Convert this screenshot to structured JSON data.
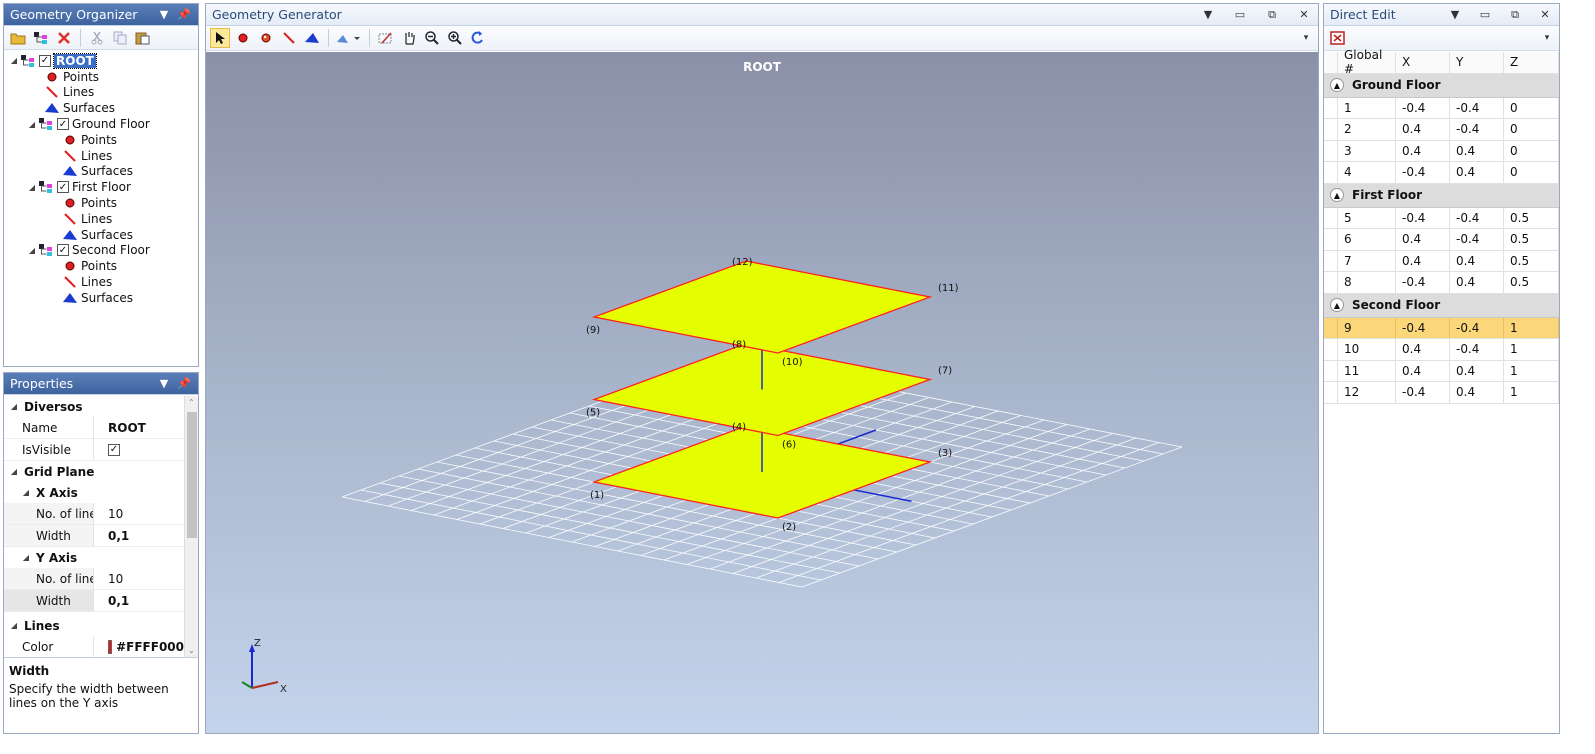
{
  "organizer": {
    "title": "Geometry Organizer",
    "tree": [
      {
        "label": "ROOT",
        "type": "group",
        "level": 0,
        "checked": true,
        "selected": true
      },
      {
        "label": "Points",
        "type": "points",
        "level": 1
      },
      {
        "label": "Lines",
        "type": "lines",
        "level": 1
      },
      {
        "label": "Surfaces",
        "type": "surfaces",
        "level": 1
      },
      {
        "label": "Ground Floor",
        "type": "group",
        "level": 1,
        "checked": true
      },
      {
        "label": "Points",
        "type": "points",
        "level": 2
      },
      {
        "label": "Lines",
        "type": "lines",
        "level": 2
      },
      {
        "label": "Surfaces",
        "type": "surfaces",
        "level": 2
      },
      {
        "label": "First Floor",
        "type": "group",
        "level": 1,
        "checked": true
      },
      {
        "label": "Points",
        "type": "points",
        "level": 2
      },
      {
        "label": "Lines",
        "type": "lines",
        "level": 2
      },
      {
        "label": "Surfaces",
        "type": "surfaces",
        "level": 2
      },
      {
        "label": "Second Floor",
        "type": "group",
        "level": 1,
        "checked": true
      },
      {
        "label": "Points",
        "type": "points",
        "level": 2
      },
      {
        "label": "Lines",
        "type": "lines",
        "level": 2
      },
      {
        "label": "Surfaces",
        "type": "surfaces",
        "level": 2
      }
    ]
  },
  "properties": {
    "title": "Properties",
    "cat_diversos": "Diversos",
    "name_label": "Name",
    "name_value": "ROOT",
    "isvisible_label": "IsVisible",
    "cat_grid": "Grid Plane",
    "xaxis": "X Axis",
    "x_lines_label": "No. of line",
    "x_lines_value": "10",
    "x_width_label": "Width",
    "x_width_value": "0,1",
    "yaxis": "Y Axis",
    "y_lines_label": "No. of line",
    "y_lines_value": "10",
    "y_width_label": "Width",
    "y_width_value": "0,1",
    "cat_lines": "Lines",
    "color_label": "Color",
    "color_value": "#FFFF000",
    "color_swatch": "#ee1111",
    "desc_title": "Width",
    "desc_text": "Specify the width between lines on the Y axis"
  },
  "generator": {
    "title": "Geometry Generator",
    "viewport_title": "ROOT",
    "point_labels": [
      "(1)",
      "(2)",
      "(3)",
      "(4)",
      "(5)",
      "(6)",
      "(7)",
      "(8)",
      "(9)",
      "(10)",
      "(11)",
      "(12)"
    ],
    "axis_z": "Z",
    "axis_x": "X",
    "surface_color": "#e6ff00",
    "edge_color": "#ff2020"
  },
  "direct_edit": {
    "title": "Direct Edit",
    "columns": [
      "Global #",
      "X",
      "Y",
      "Z"
    ],
    "groups": [
      {
        "name": "Ground Floor",
        "rows": [
          [
            "1",
            "-0.4",
            "-0.4",
            "0"
          ],
          [
            "2",
            "0.4",
            "-0.4",
            "0"
          ],
          [
            "3",
            "0.4",
            "0.4",
            "0"
          ],
          [
            "4",
            "-0.4",
            "0.4",
            "0"
          ]
        ]
      },
      {
        "name": "First Floor",
        "rows": [
          [
            "5",
            "-0.4",
            "-0.4",
            "0.5"
          ],
          [
            "6",
            "0.4",
            "-0.4",
            "0.5"
          ],
          [
            "7",
            "0.4",
            "0.4",
            "0.5"
          ],
          [
            "8",
            "-0.4",
            "0.4",
            "0.5"
          ]
        ]
      },
      {
        "name": "Second Floor",
        "rows": [
          [
            "9",
            "-0.4",
            "-0.4",
            "1"
          ],
          [
            "10",
            "0.4",
            "-0.4",
            "1"
          ],
          [
            "11",
            "0.4",
            "0.4",
            "1"
          ],
          [
            "12",
            "-0.4",
            "0.4",
            "1"
          ]
        ]
      }
    ],
    "selected_row": "9",
    "selected_color": "#fcd77a"
  }
}
